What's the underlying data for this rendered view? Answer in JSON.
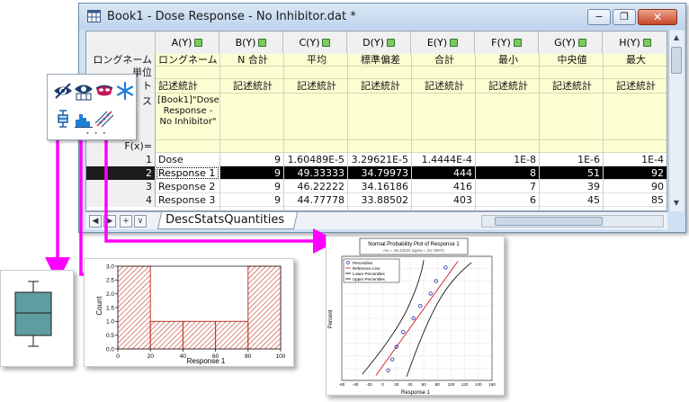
{
  "window": {
    "title": "Book1 - Dose Response - No Inhibitor.dat *",
    "minimize_glyph": "−",
    "restore_glyph": "❐",
    "close_glyph": "✕"
  },
  "sheet": {
    "columns": [
      {
        "letter": "A(Y)",
        "longname": "ロングネーム",
        "unit": "",
        "comment": "記述統計",
        "label4": "[Book1]\"Dose Response - No Inhibitor\"",
        "label5": ""
      },
      {
        "letter": "B(Y)",
        "longname": "N 合計",
        "unit": "",
        "comment": "記述統計",
        "label4": "",
        "label5": ""
      },
      {
        "letter": "C(Y)",
        "longname": "平均",
        "unit": "",
        "comment": "記述統計",
        "label4": "",
        "label5": ""
      },
      {
        "letter": "D(Y)",
        "longname": "標準偏差",
        "unit": "",
        "comment": "記述統計",
        "label4": "",
        "label5": ""
      },
      {
        "letter": "E(Y)",
        "longname": "合計",
        "unit": "",
        "comment": "記述統計",
        "label4": "",
        "label5": ""
      },
      {
        "letter": "F(Y)",
        "longname": "最小",
        "unit": "",
        "comment": "記述統計",
        "label4": "",
        "label5": ""
      },
      {
        "letter": "G(Y)",
        "longname": "中央値",
        "unit": "",
        "comment": "記述統計",
        "label4": "",
        "label5": ""
      },
      {
        "letter": "H(Y)",
        "longname": "最大",
        "unit": "",
        "comment": "記述統計",
        "label4": "",
        "label5": ""
      }
    ],
    "row_headers": [
      "ロングネーム",
      "単位",
      "ト",
      "ス",
      "F(x)="
    ],
    "rows": [
      {
        "num": "1",
        "cells": [
          "Dose",
          "9",
          "1.60489E-5",
          "3.29621E-5",
          "1.4444E-4",
          "1E-8",
          "1E-6",
          "1E-4"
        ]
      },
      {
        "num": "2",
        "cells": [
          "Response 1",
          "9",
          "49.33333",
          "34.79973",
          "444",
          "8",
          "51",
          "92"
        ]
      },
      {
        "num": "3",
        "cells": [
          "Response 2",
          "9",
          "46.22222",
          "34.16186",
          "416",
          "7",
          "39",
          "90"
        ]
      },
      {
        "num": "4",
        "cells": [
          "Response 3",
          "9",
          "44.77778",
          "33.88502",
          "403",
          "6",
          "45",
          "85"
        ]
      }
    ],
    "selected_row": 1,
    "tab_label": "DescStatsQuantities"
  },
  "nav": {
    "first": "◀",
    "next": "▶",
    "add": "+",
    "menu": "∨"
  },
  "scroll": {
    "up": "▲",
    "down": "▼",
    "left": "◀",
    "right": "▶"
  },
  "minitoolbar": {
    "icons": [
      "eye-icon",
      "eye-grid-icon",
      "mask-icon",
      "snowflake-icon",
      "box-chart-icon",
      "histogram-icon",
      "probability-plot-icon"
    ],
    "grip": "• • •"
  },
  "histogram": {
    "chart_data": {
      "type": "bar",
      "bins": [
        [
          0,
          20
        ],
        [
          20,
          40
        ],
        [
          40,
          60
        ],
        [
          60,
          80
        ],
        [
          80,
          100
        ]
      ],
      "values": [
        3,
        1,
        1,
        1,
        3
      ],
      "xlabel": "Response 1",
      "ylabel": "Count",
      "xlim": [
        0,
        100
      ],
      "ylim": [
        0,
        3.0
      ],
      "xticks": [
        "0",
        "20",
        "40",
        "60",
        "80",
        "100"
      ],
      "yticks": [
        "0.0",
        "0.5",
        "1.0",
        "1.5",
        "2.0",
        "2.5",
        "3.0"
      ],
      "bar_color": "#c0392b"
    }
  },
  "probplot": {
    "chart_data": {
      "type": "scatter",
      "title": "Normal Probability Plot of Response 1",
      "subtitle": "mu = 49.33333  sigma = 34.79973",
      "xlabel": "Response 1",
      "ylabel": "Percent",
      "xlim": [
        -60,
        160
      ],
      "xticks": [
        "-60",
        "-40",
        "-20",
        "0",
        "20",
        "40",
        "60",
        "80",
        "100",
        "120",
        "140",
        "160"
      ],
      "legend": [
        "Percentiles",
        "Reference Line",
        "Lower Percentiles",
        "Upper Percentiles"
      ],
      "points": [
        [
          8,
          8
        ],
        [
          14,
          17
        ],
        [
          20,
          27
        ],
        [
          30,
          39
        ],
        [
          45,
          50
        ],
        [
          55,
          60
        ],
        [
          70,
          70
        ],
        [
          78,
          80
        ],
        [
          92,
          91
        ]
      ]
    }
  },
  "boxchart": {
    "label": ""
  }
}
